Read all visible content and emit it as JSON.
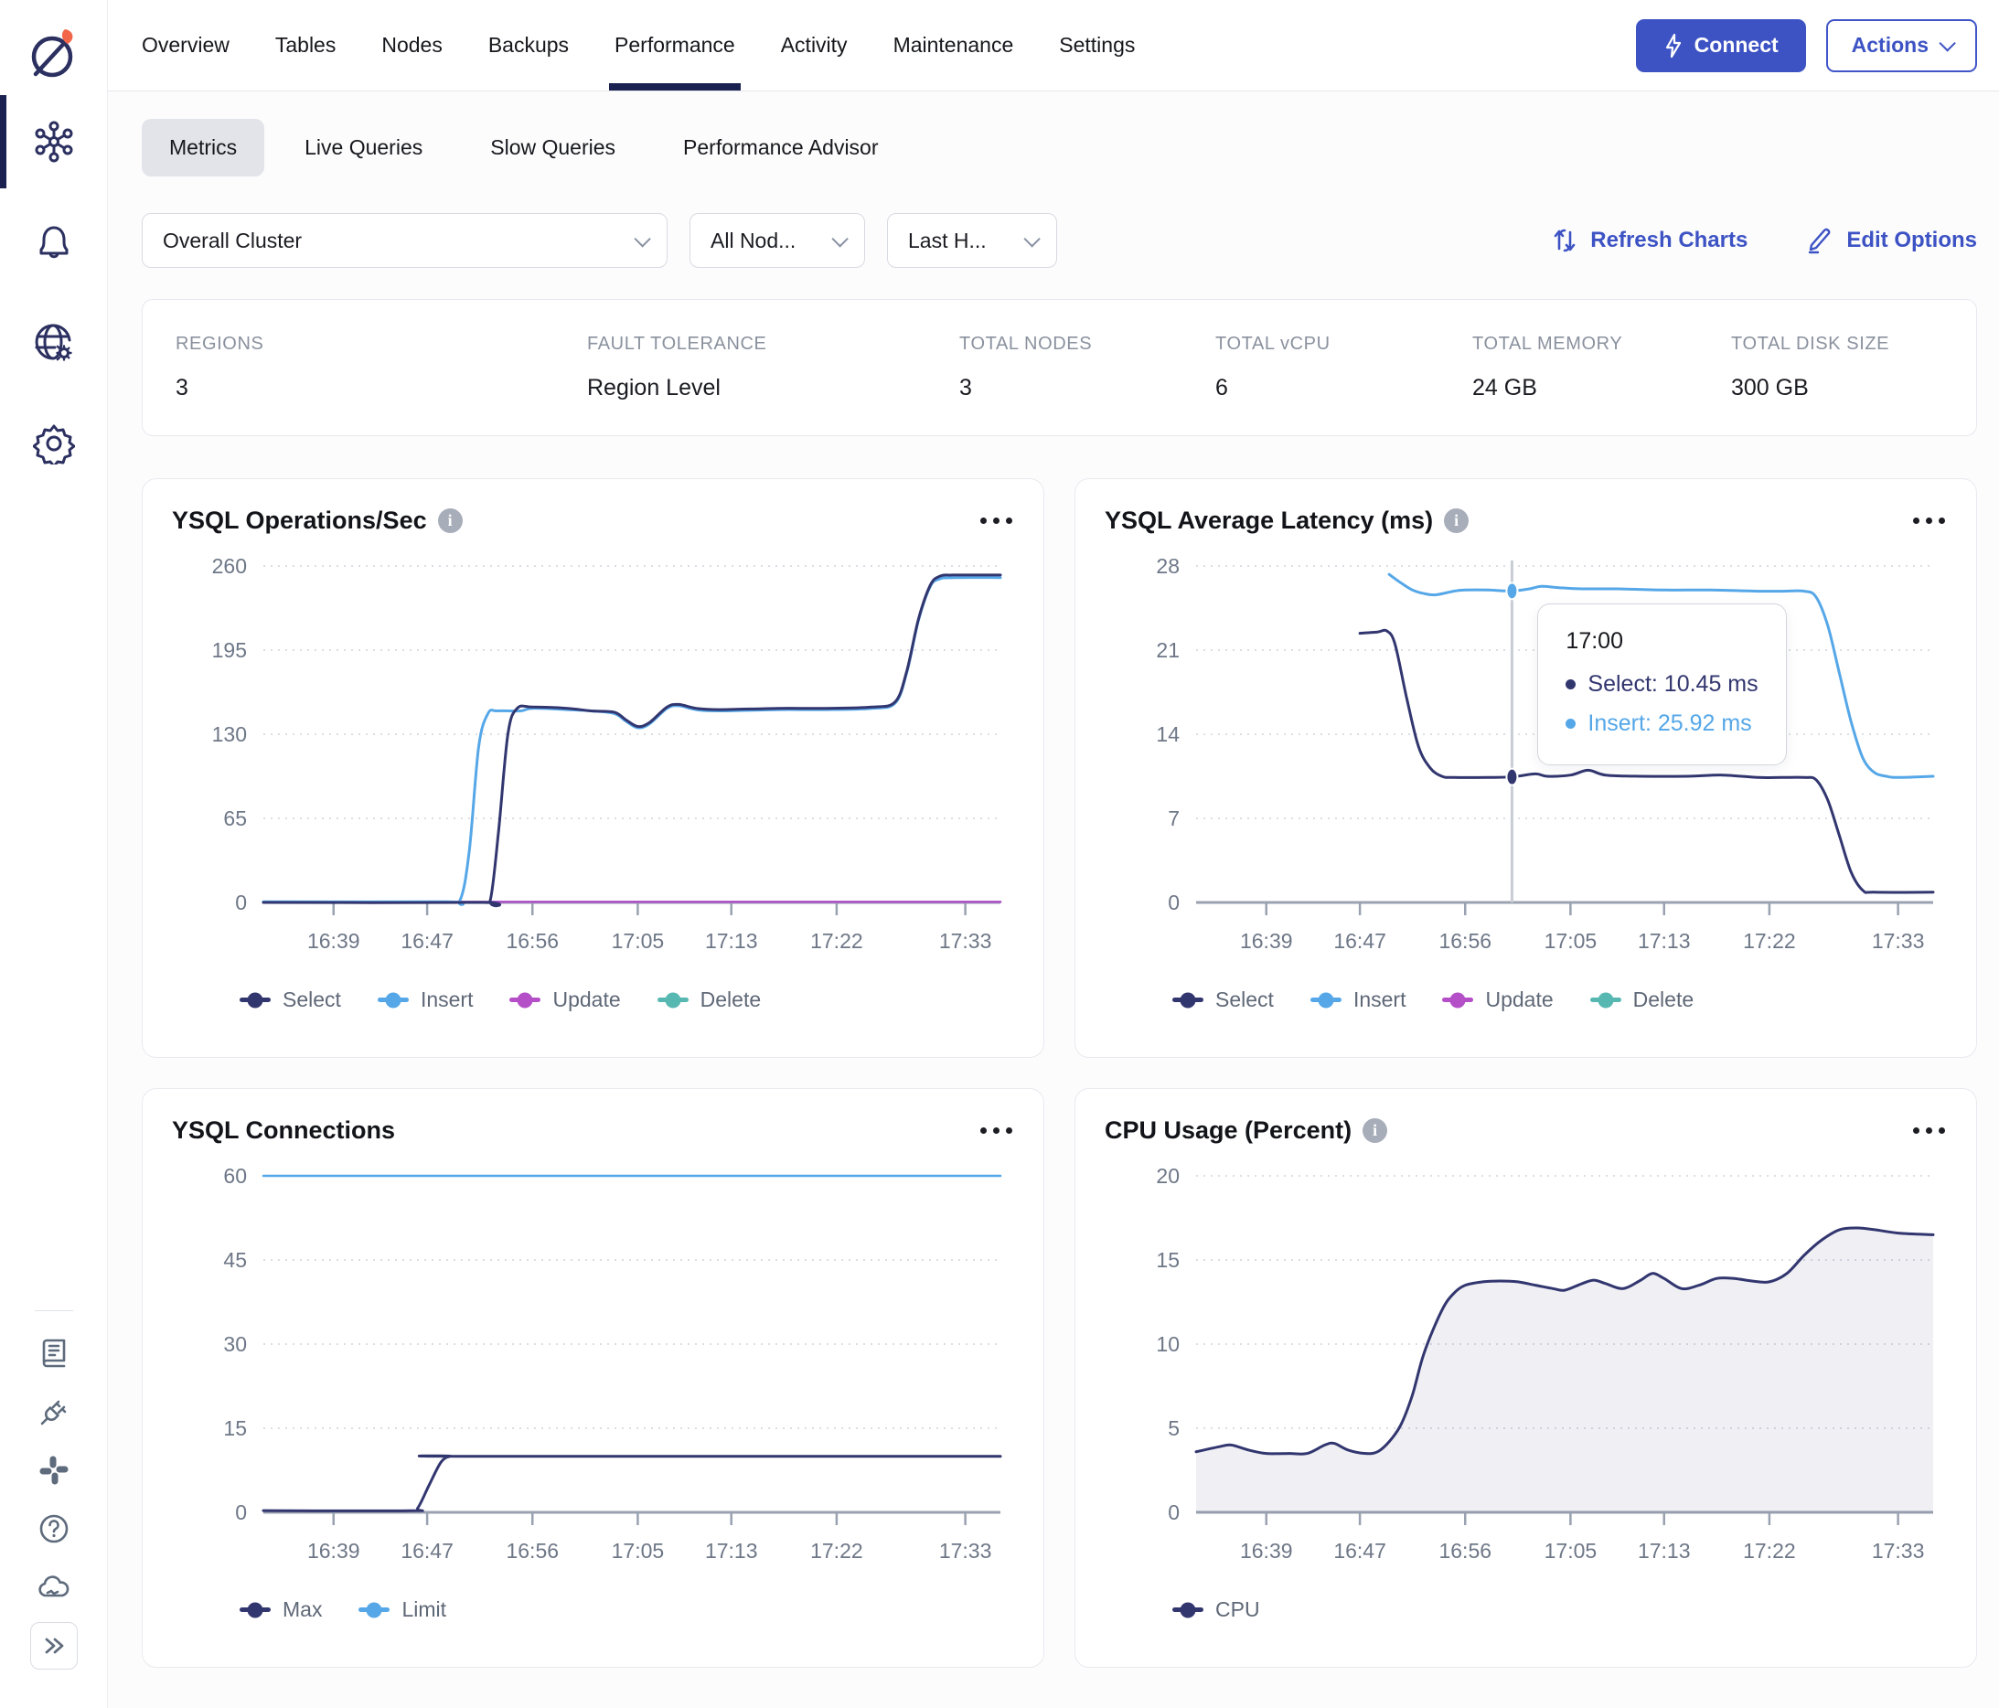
{
  "header": {
    "tabs": [
      "Overview",
      "Tables",
      "Nodes",
      "Backups",
      "Performance",
      "Activity",
      "Maintenance",
      "Settings"
    ],
    "active_tab": "Performance",
    "connect_label": "Connect",
    "actions_label": "Actions"
  },
  "subnav": {
    "tabs": [
      "Metrics",
      "Live Queries",
      "Slow Queries",
      "Performance Advisor"
    ],
    "active": "Metrics"
  },
  "filters": {
    "cluster": "Overall Cluster",
    "nodes": "All Nod...",
    "time": "Last H...",
    "refresh_label": "Refresh Charts",
    "edit_label": "Edit Options"
  },
  "stats": [
    {
      "label": "REGIONS",
      "value": "3"
    },
    {
      "label": "FAULT TOLERANCE",
      "value": "Region Level"
    },
    {
      "label": "TOTAL NODES",
      "value": "3"
    },
    {
      "label": "TOTAL vCPU",
      "value": "6"
    },
    {
      "label": "TOTAL MEMORY",
      "value": "24 GB"
    },
    {
      "label": "TOTAL DISK SIZE",
      "value": "300 GB"
    }
  ],
  "sidebar": {
    "top_icons": [
      "cluster",
      "notifications",
      "network-settings",
      "settings"
    ],
    "bottom_icons": [
      "docs",
      "integrations",
      "slack",
      "help",
      "cloud-status",
      "expand"
    ]
  },
  "colors": {
    "accent": "#3d53c4",
    "select_navy": "#32366f",
    "insert_blue": "#55a7e8",
    "update_magenta": "#b44fc8",
    "delete_teal": "#57b7b1",
    "axis_grey": "#9aa2b1",
    "label_grey": "#6e7787"
  },
  "chart_data": [
    {
      "type": "line",
      "title": "YSQL Operations/Sec",
      "has_info": true,
      "xlim": [
        0,
        63
      ],
      "ylim": [
        0,
        260
      ],
      "y_ticks": [
        0,
        65,
        130,
        195,
        260
      ],
      "x_ticks": [
        {
          "t": 6,
          "label": "16:39"
        },
        {
          "t": 14,
          "label": "16:47"
        },
        {
          "t": 23,
          "label": "16:56"
        },
        {
          "t": 32,
          "label": "17:05"
        },
        {
          "t": 40,
          "label": "17:13"
        },
        {
          "t": 49,
          "label": "17:22"
        },
        {
          "t": 60,
          "label": "17:33"
        }
      ],
      "legend": [
        "Select",
        "Insert",
        "Update",
        "Delete"
      ],
      "series": [
        {
          "name": "Delete",
          "color": "#57b7b1",
          "width": 2.5,
          "points": [
            [
              0,
              0.4
            ],
            [
              63,
              0.4
            ]
          ]
        },
        {
          "name": "Update",
          "color": "#b44fc8",
          "width": 2.5,
          "points": [
            [
              0,
              0.4
            ],
            [
              63,
              0.4
            ]
          ]
        },
        {
          "name": "Insert",
          "color": "#55a7e8",
          "width": 3,
          "points": [
            [
              0,
              0.5
            ],
            [
              15.5,
              0.5
            ],
            [
              16.8,
              1.5
            ],
            [
              17.6,
              40
            ],
            [
              18.4,
              120
            ],
            [
              19.2,
              146
            ],
            [
              20,
              148
            ],
            [
              22,
              148
            ],
            [
              23,
              150
            ],
            [
              26,
              149
            ],
            [
              28,
              148
            ],
            [
              30,
              146
            ],
            [
              31,
              140
            ],
            [
              32,
              135
            ],
            [
              33,
              138
            ],
            [
              34.5,
              150
            ],
            [
              35.5,
              152
            ],
            [
              37,
              149
            ],
            [
              39,
              148
            ],
            [
              44,
              149
            ],
            [
              48,
              149
            ],
            [
              52,
              150
            ],
            [
              54,
              154
            ],
            [
              55,
              178
            ],
            [
              56,
              218
            ],
            [
              57,
              244
            ],
            [
              57.8,
              250
            ],
            [
              59,
              251
            ],
            [
              63,
              251
            ]
          ]
        },
        {
          "name": "Select",
          "color": "#32366f",
          "width": 3,
          "points": [
            [
              0,
              0
            ],
            [
              18.6,
              0
            ],
            [
              19.4,
              2
            ],
            [
              20.1,
              55
            ],
            [
              20.9,
              130
            ],
            [
              21.7,
              150
            ],
            [
              23,
              151
            ],
            [
              26,
              150
            ],
            [
              28,
              148
            ],
            [
              30,
              147
            ],
            [
              31,
              141
            ],
            [
              32,
              136
            ],
            [
              33,
              139
            ],
            [
              34.5,
              151
            ],
            [
              35.5,
              153
            ],
            [
              37,
              150
            ],
            [
              39,
              149
            ],
            [
              44,
              150
            ],
            [
              48,
              150
            ],
            [
              52,
              151
            ],
            [
              54,
              155
            ],
            [
              55,
              179
            ],
            [
              56,
              219
            ],
            [
              57,
              245
            ],
            [
              57.8,
              252
            ],
            [
              59,
              253
            ],
            [
              63,
              253
            ]
          ]
        }
      ]
    },
    {
      "type": "line",
      "title": "YSQL Average Latency (ms)",
      "has_info": true,
      "xlim": [
        0,
        63
      ],
      "ylim": [
        0,
        28
      ],
      "y_ticks": [
        0,
        7,
        14,
        21,
        28
      ],
      "x_ticks": [
        {
          "t": 6,
          "label": "16:39"
        },
        {
          "t": 14,
          "label": "16:47"
        },
        {
          "t": 23,
          "label": "16:56"
        },
        {
          "t": 32,
          "label": "17:05"
        },
        {
          "t": 40,
          "label": "17:13"
        },
        {
          "t": 49,
          "label": "17:22"
        },
        {
          "t": 60,
          "label": "17:33"
        }
      ],
      "legend": [
        "Select",
        "Insert",
        "Update",
        "Delete"
      ],
      "series": [
        {
          "name": "Update",
          "color": "#b44fc8",
          "width": 2.5,
          "points": []
        },
        {
          "name": "Delete",
          "color": "#57b7b1",
          "width": 2.5,
          "points": []
        },
        {
          "name": "Insert",
          "color": "#55a7e8",
          "width": 3,
          "points": [
            [
              16.5,
              27.3
            ],
            [
              17.5,
              26.6
            ],
            [
              18.5,
              26.0
            ],
            [
              19.5,
              25.7
            ],
            [
              20.5,
              25.6
            ],
            [
              22,
              25.9
            ],
            [
              23,
              26.0
            ],
            [
              25,
              26.0
            ],
            [
              27,
              25.92
            ],
            [
              28.5,
              26.1
            ],
            [
              29.5,
              26.3
            ],
            [
              31,
              26.2
            ],
            [
              33,
              26.1
            ],
            [
              36,
              26.1
            ],
            [
              40,
              26.0
            ],
            [
              44,
              26.0
            ],
            [
              48,
              25.9
            ],
            [
              50,
              25.9
            ],
            [
              52,
              25.9
            ],
            [
              53,
              25.4
            ],
            [
              54,
              23
            ],
            [
              55,
              19
            ],
            [
              56,
              15
            ],
            [
              57,
              12
            ],
            [
              58,
              10.8
            ],
            [
              59,
              10.5
            ],
            [
              60,
              10.4
            ],
            [
              63,
              10.5
            ]
          ]
        },
        {
          "name": "Select",
          "color": "#32366f",
          "width": 3,
          "points": [
            [
              14,
              22.4
            ],
            [
              15.5,
              22.5
            ],
            [
              16.3,
              22.6
            ],
            [
              17,
              21.5
            ],
            [
              18,
              17
            ],
            [
              19,
              13
            ],
            [
              20,
              11.2
            ],
            [
              21,
              10.5
            ],
            [
              22,
              10.4
            ],
            [
              25,
              10.4
            ],
            [
              27,
              10.45
            ],
            [
              29,
              10.7
            ],
            [
              30,
              10.5
            ],
            [
              32,
              10.6
            ],
            [
              33.5,
              11.0
            ],
            [
              35,
              10.6
            ],
            [
              38,
              10.5
            ],
            [
              42,
              10.5
            ],
            [
              45,
              10.6
            ],
            [
              48,
              10.4
            ],
            [
              50,
              10.4
            ],
            [
              52,
              10.4
            ],
            [
              53,
              10.2
            ],
            [
              54,
              8.5
            ],
            [
              55,
              5.5
            ],
            [
              56,
              2.5
            ],
            [
              57,
              1.0
            ],
            [
              58,
              0.85
            ],
            [
              63,
              0.85
            ]
          ]
        }
      ],
      "crosshair": {
        "x": 27,
        "markers": [
          {
            "y": 10.45,
            "color": "#32366f"
          },
          {
            "y": 25.92,
            "color": "#55a7e8"
          }
        ]
      },
      "tooltip": {
        "time": "17:00",
        "rows": [
          {
            "text": "Select: 10.45 ms",
            "color": "#32366f"
          },
          {
            "text": "Insert: 25.92 ms",
            "color": "#55a7e8"
          }
        ]
      }
    },
    {
      "type": "line",
      "title": "YSQL Connections",
      "has_info": false,
      "xlim": [
        0,
        63
      ],
      "ylim": [
        0,
        60
      ],
      "y_ticks": [
        0,
        15,
        30,
        45,
        60
      ],
      "x_ticks": [
        {
          "t": 6,
          "label": "16:39"
        },
        {
          "t": 14,
          "label": "16:47"
        },
        {
          "t": 23,
          "label": "16:56"
        },
        {
          "t": 32,
          "label": "17:05"
        },
        {
          "t": 40,
          "label": "17:13"
        },
        {
          "t": 49,
          "label": "17:22"
        },
        {
          "t": 60,
          "label": "17:33"
        }
      ],
      "legend": [
        "Max",
        "Limit"
      ],
      "series": [
        {
          "name": "Limit",
          "color": "#55a7e8",
          "width": 2.5,
          "points": [
            [
              0,
              60
            ],
            [
              63,
              60
            ]
          ]
        },
        {
          "name": "Max",
          "color": "#32366f",
          "width": 3,
          "points": [
            [
              0,
              0.3
            ],
            [
              12.5,
              0.3
            ],
            [
              13.2,
              0.8
            ],
            [
              14.2,
              5
            ],
            [
              15.2,
              9
            ],
            [
              16,
              10
            ],
            [
              17,
              10
            ],
            [
              63,
              10
            ]
          ]
        }
      ]
    },
    {
      "type": "area",
      "title": "CPU Usage (Percent)",
      "has_info": true,
      "xlim": [
        0,
        63
      ],
      "ylim": [
        0,
        20
      ],
      "y_ticks": [
        0,
        5,
        10,
        15,
        20
      ],
      "x_ticks": [
        {
          "t": 6,
          "label": "16:39"
        },
        {
          "t": 14,
          "label": "16:47"
        },
        {
          "t": 23,
          "label": "16:56"
        },
        {
          "t": 32,
          "label": "17:05"
        },
        {
          "t": 40,
          "label": "17:13"
        },
        {
          "t": 49,
          "label": "17:22"
        },
        {
          "t": 60,
          "label": "17:33"
        }
      ],
      "legend": [
        "CPU"
      ],
      "series": [
        {
          "name": "CPU",
          "color": "#32366f",
          "width": 3,
          "area": true,
          "fill": "rgba(48,53,113,0.08)",
          "points": [
            [
              0,
              3.6
            ],
            [
              2,
              3.9
            ],
            [
              3,
              4.0
            ],
            [
              4.5,
              3.7
            ],
            [
              6,
              3.5
            ],
            [
              8,
              3.5
            ],
            [
              9.5,
              3.5
            ],
            [
              11,
              4.0
            ],
            [
              11.8,
              4.1
            ],
            [
              13,
              3.7
            ],
            [
              14.5,
              3.5
            ],
            [
              15.5,
              3.6
            ],
            [
              16.5,
              4.2
            ],
            [
              17.5,
              5.2
            ],
            [
              18.5,
              7.0
            ],
            [
              19.5,
              9.5
            ],
            [
              21,
              12.0
            ],
            [
              22,
              13.0
            ],
            [
              23,
              13.5
            ],
            [
              24.5,
              13.7
            ],
            [
              26,
              13.75
            ],
            [
              27.5,
              13.7
            ],
            [
              29,
              13.5
            ],
            [
              30.5,
              13.3
            ],
            [
              31.5,
              13.2
            ],
            [
              33,
              13.6
            ],
            [
              34,
              13.8
            ],
            [
              35,
              13.6
            ],
            [
              36.5,
              13.3
            ],
            [
              38,
              13.8
            ],
            [
              39,
              14.2
            ],
            [
              40,
              13.9
            ],
            [
              41.5,
              13.3
            ],
            [
              43,
              13.5
            ],
            [
              44.5,
              13.9
            ],
            [
              46,
              13.9
            ],
            [
              47.5,
              13.75
            ],
            [
              49,
              13.7
            ],
            [
              50.5,
              14.2
            ],
            [
              52,
              15.3
            ],
            [
              53.5,
              16.2
            ],
            [
              55,
              16.8
            ],
            [
              56.5,
              16.9
            ],
            [
              58,
              16.8
            ],
            [
              60,
              16.6
            ],
            [
              63,
              16.5
            ]
          ]
        }
      ]
    }
  ]
}
